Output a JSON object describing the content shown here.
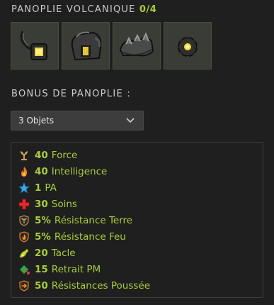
{
  "panoply": {
    "title": "PANOPLIE VOLCANIQUE",
    "count": "0/4",
    "items": [
      {
        "icon": "amulet-icon"
      },
      {
        "icon": "backpack-icon"
      },
      {
        "icon": "boots-icon"
      },
      {
        "icon": "belt-icon"
      }
    ]
  },
  "bonus": {
    "label": "BONUS DE PANOPLIE :",
    "selected": "3 Objets"
  },
  "stats": [
    {
      "value": "40",
      "label": "Force",
      "icon": "strength-icon"
    },
    {
      "value": "40",
      "label": "Intelligence",
      "icon": "intelligence-icon"
    },
    {
      "value": "1",
      "label": "PA",
      "icon": "ap-star-icon"
    },
    {
      "value": "30",
      "label": "Soins",
      "icon": "heal-cross-icon"
    },
    {
      "value": "5%",
      "label": "Résistance Terre",
      "icon": "earth-resistance-icon"
    },
    {
      "value": "5%",
      "label": "Résistance Feu",
      "icon": "fire-resistance-icon"
    },
    {
      "value": "20",
      "label": "Tacle",
      "icon": "lock-icon"
    },
    {
      "value": "15",
      "label": "Retrait PM",
      "icon": "mp-removal-icon"
    },
    {
      "value": "50",
      "label": "Résistances Poussée",
      "icon": "pushback-resistance-icon"
    }
  ],
  "colors": {
    "accent": "#a8cc3a",
    "background": "#1f1f1f",
    "item_bg": "#3a3d36"
  }
}
